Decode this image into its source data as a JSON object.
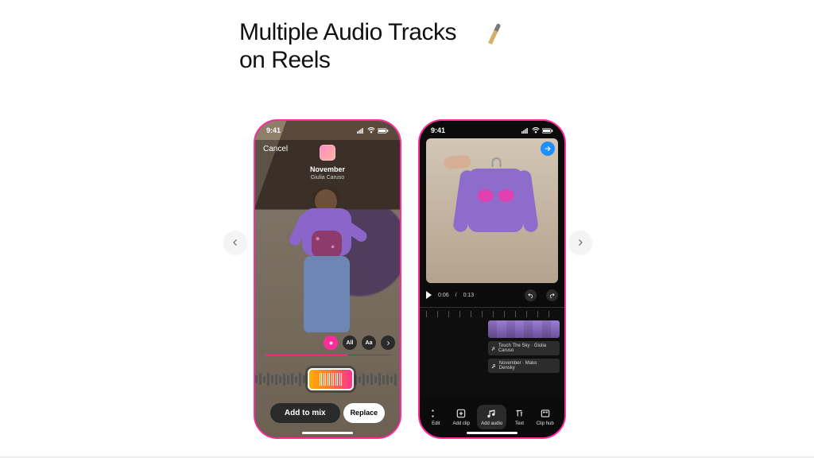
{
  "headline": "Multiple Audio Tracks\non Reels",
  "status_time": "9:41",
  "phone1": {
    "cancel": "Cancel",
    "track_title": "November",
    "track_artist": "Giulia Caruso",
    "tool_all": "All",
    "tool_aa": "Aa",
    "add_to_mix": "Add to mix",
    "replace": "Replace"
  },
  "phone2": {
    "time_current": "0:06",
    "time_total": "0:13",
    "audio_track_1": "Touch The Sky · Giulia Caruso",
    "audio_track_2": "November · Mako Densky",
    "toolbar": {
      "edit": "Edit",
      "add_clip": "Add clip",
      "add_audio": "Add audio",
      "text": "Text",
      "clip_hub": "Clip hub"
    }
  }
}
